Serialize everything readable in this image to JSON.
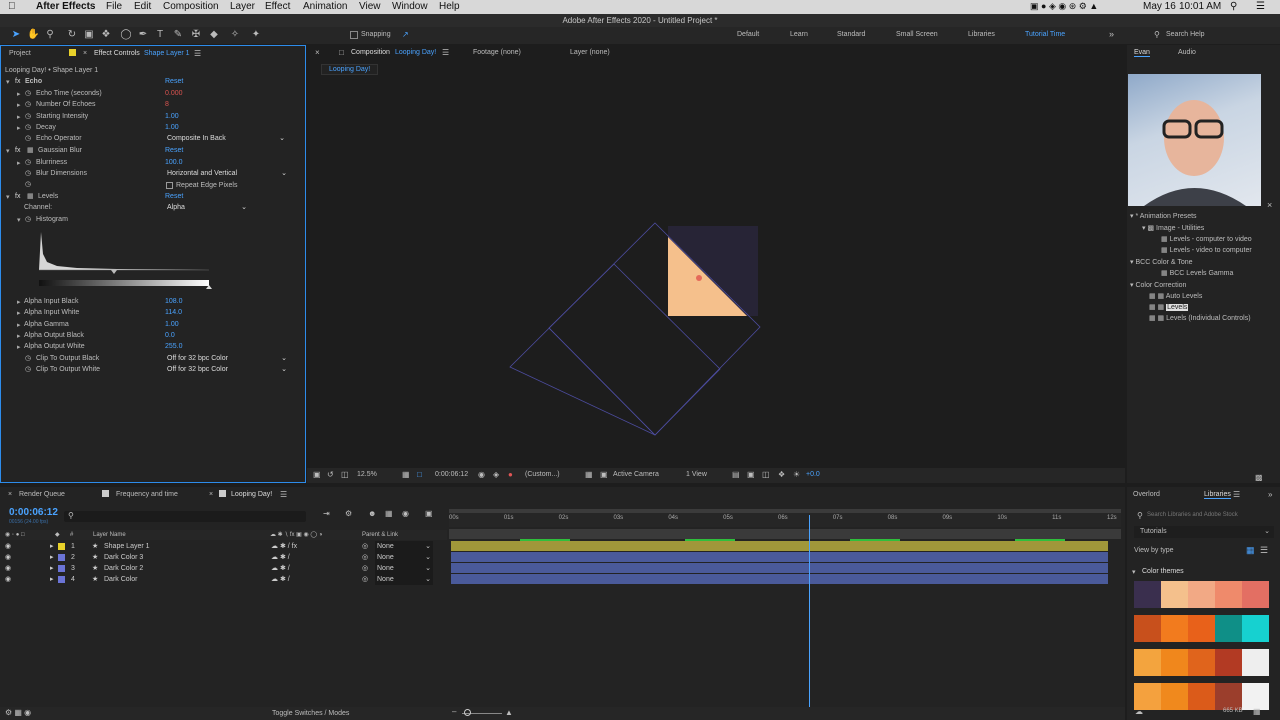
{
  "menubar": {
    "app": "After Effects",
    "items": [
      "File",
      "Edit",
      "Composition",
      "Layer",
      "Effect",
      "Animation",
      "View",
      "Window",
      "Help"
    ],
    "date": "May 16",
    "time": "10:01 AM"
  },
  "titlebar": "Adobe After Effects 2020 - Untitled Project *",
  "toolbar": {
    "snapping": "Snapping",
    "workspaces": [
      "Default",
      "Learn",
      "Standard",
      "Small Screen",
      "Libraries",
      "Tutorial Time"
    ],
    "search_placeholder": "Search Help"
  },
  "effect_controls": {
    "tab_project": "Project",
    "tab_label": "Effect Controls",
    "tab_layer": "Shape Layer 1",
    "breadcrumb": "Looping Day! • Shape Layer 1",
    "reset": "Reset",
    "echo": {
      "name": "Echo",
      "props": [
        {
          "label": "Echo Time (seconds)",
          "value": "0.000"
        },
        {
          "label": "Number Of Echoes",
          "value": "8"
        },
        {
          "label": "Starting Intensity",
          "value": "1.00"
        },
        {
          "label": "Decay",
          "value": "1.00"
        },
        {
          "label": "Echo Operator",
          "value": "Composite In Back"
        }
      ]
    },
    "blur": {
      "name": "Gaussian Blur",
      "props": [
        {
          "label": "Blurriness",
          "value": "100.0"
        },
        {
          "label": "Blur Dimensions",
          "value": "Horizontal and Vertical"
        }
      ],
      "checkbox": "Repeat Edge Pixels"
    },
    "levels": {
      "name": "Levels",
      "channel_label": "Channel:",
      "channel": "Alpha",
      "histogram": "Histogram",
      "props": [
        {
          "label": "Alpha Input Black",
          "value": "108.0"
        },
        {
          "label": "Alpha Input White",
          "value": "114.0"
        },
        {
          "label": "Alpha Gamma",
          "value": "1.00"
        },
        {
          "label": "Alpha Output Black",
          "value": "0.0"
        },
        {
          "label": "Alpha Output White",
          "value": "255.0"
        }
      ],
      "clip_black": {
        "label": "Clip To Output Black",
        "value": "Off for 32 bpc Color"
      },
      "clip_white": {
        "label": "Clip To Output White",
        "value": "Off for 32 bpc Color"
      }
    }
  },
  "composition": {
    "tab_prefix": "Composition",
    "comp_name": "Looping Day!",
    "footage": "Footage (none)",
    "layer": "Layer (none)",
    "sub_tab": "Looping Day!",
    "footer": {
      "zoom": "12.5%",
      "timecode": "0:00:06:12",
      "resolution": "(Custom...)",
      "camera": "Active Camera",
      "views": "1 View",
      "exposure": "+0.0"
    }
  },
  "right_panel": {
    "tabs": [
      "Evan",
      "Audio"
    ],
    "tree": [
      {
        "label": "* Animation Presets",
        "level": 0
      },
      {
        "label": "Image - Utilities",
        "level": 1
      },
      {
        "label": "Levels - computer to video",
        "level": 2
      },
      {
        "label": "Levels - video to computer",
        "level": 2
      },
      {
        "label": "BCC Color & Tone",
        "level": 0
      },
      {
        "label": "BCC Levels Gamma",
        "level": 2
      },
      {
        "label": "Color Correction",
        "level": 0
      },
      {
        "label": "Auto Levels",
        "level": 2
      },
      {
        "label": "Levels",
        "level": 2,
        "selected": true
      },
      {
        "label": "Levels (Individual Controls)",
        "level": 2
      }
    ]
  },
  "timeline": {
    "tabs": [
      "Render Queue",
      "Frequency and time",
      "Looping Day!"
    ],
    "timecode": "0:00:06:12",
    "timecode_sub": "00156 (24.00 fps)",
    "col_layer": "Layer Name",
    "col_parent": "Parent & Link",
    "parent_none": "None",
    "layers": [
      {
        "num": "1",
        "name": "Shape Layer 1",
        "color": "#e8d12a"
      },
      {
        "num": "2",
        "name": "Dark Color 3",
        "color": "#6b74d6"
      },
      {
        "num": "3",
        "name": "Dark Color 2",
        "color": "#6b74d6"
      },
      {
        "num": "4",
        "name": "Dark Color",
        "color": "#6b74d6"
      }
    ],
    "ruler": [
      "00s",
      "01s",
      "02s",
      "03s",
      "04s",
      "05s",
      "06s",
      "07s",
      "08s",
      "09s",
      "10s",
      "11s",
      "12s"
    ],
    "playhead_seconds": 6.5,
    "toggle": "Toggle Switches / Modes"
  },
  "libraries": {
    "tabs": [
      "Overlord",
      "Libraries"
    ],
    "search_placeholder": "Search Libraries and Adobe Stock",
    "library": "Tutorials",
    "view": "View by type",
    "section": "Color themes",
    "size": "665 KB",
    "themes": [
      [
        "#3a2f4e",
        "#f4c08c",
        "#f2a985",
        "#ef8a6b",
        "#e36f63"
      ],
      [
        "#c8501c",
        "#f27b1e",
        "#e8611a",
        "#0f8f87",
        "#16d1d0"
      ],
      [
        "#f3a43e",
        "#f0871c",
        "#e0641c",
        "#b23a23",
        "#eeeeee"
      ],
      [
        "#f4a13e",
        "#f0891d",
        "#db5b1a",
        "#9b3e2c",
        "#f2f2f2"
      ]
    ]
  },
  "colors": {
    "accent": "#2d8ceb",
    "comp_bg": "#272436",
    "triangle": "#f5c08c"
  }
}
